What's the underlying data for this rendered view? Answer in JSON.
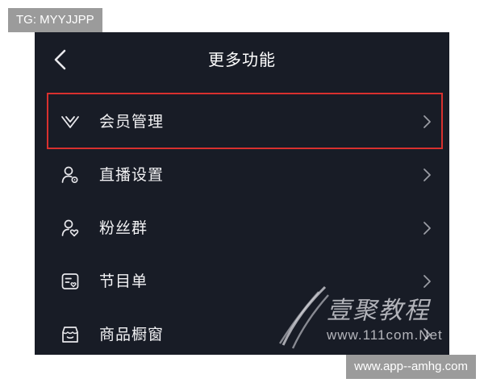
{
  "overlay": {
    "tg_label": "TG: MYYJJPP",
    "site_label": "www.app--amhg.com"
  },
  "header": {
    "title": "更多功能",
    "back_icon": "chevron-left-icon"
  },
  "menu": {
    "items": [
      {
        "label": "会员管理",
        "icon": "vip-v-icon",
        "highlighted": true
      },
      {
        "label": "直播设置",
        "icon": "user-settings-icon",
        "highlighted": false
      },
      {
        "label": "粉丝群",
        "icon": "fan-group-icon",
        "highlighted": false
      },
      {
        "label": "节目单",
        "icon": "program-list-icon",
        "highlighted": false
      },
      {
        "label": "商品橱窗",
        "icon": "shop-window-icon",
        "highlighted": false
      }
    ]
  },
  "watermark": {
    "title": "壹聚教程",
    "url": "www.111com.Net"
  },
  "colors": {
    "background": "#181c26",
    "text": "#f2f2f4",
    "highlight_border": "#d8302e",
    "label_bg": "#9b9b9b"
  }
}
